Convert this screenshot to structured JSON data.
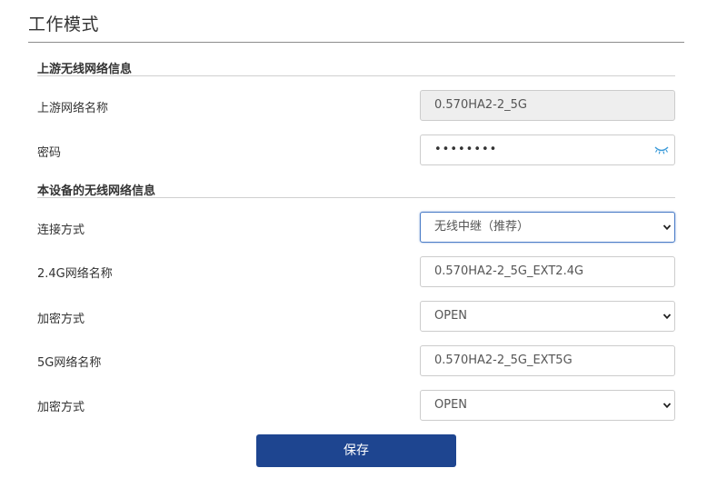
{
  "page": {
    "title": "工作模式"
  },
  "upstream": {
    "section_title": "上游无线网络信息",
    "ssid_label": "上游网络名称",
    "ssid_value": "0.570HA2-2_5G",
    "password_label": "密码",
    "password_value": "••••••••"
  },
  "device": {
    "section_title": "本设备的无线网络信息",
    "connect_mode_label": "连接方式",
    "connect_mode_value": "无线中继（推荐）",
    "ssid_24_label": "2.4G网络名称",
    "ssid_24_value": "0.570HA2-2_5G_EXT2.4G",
    "encrypt_24_label": "加密方式",
    "encrypt_24_value": "OPEN",
    "ssid_5_label": "5G网络名称",
    "ssid_5_value": "0.570HA2-2_5G_EXT5G",
    "encrypt_5_label": "加密方式",
    "encrypt_5_value": "OPEN"
  },
  "actions": {
    "save_label": "保存"
  },
  "colors": {
    "primary_button": "#1e4590",
    "focus_border": "#4a7cc7",
    "eye_icon": "#3a9ad9"
  },
  "icons": {
    "password_toggle": "eye-closed-icon",
    "select_arrow": "chevron-down-icon"
  }
}
